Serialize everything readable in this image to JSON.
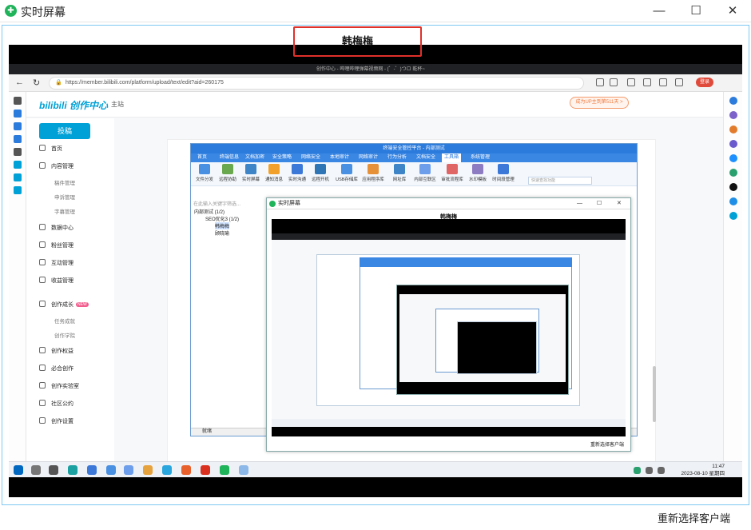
{
  "window": {
    "title": "实时屏幕",
    "controls": {
      "minimize": "—",
      "maximize": "☐",
      "close": "✕"
    }
  },
  "capture": {
    "user_name": "韩梅梅",
    "footer_button": "重新选择客户端"
  },
  "browser": {
    "tab_title": "创作中心 - 哔哩哔哩弹幕视频网 - (゜-゜)つロ 乾杯~",
    "url": "https://member.bilibili.com/platform/upload/text/edit?aid=260175",
    "login_label": "登录"
  },
  "bili": {
    "logo": "bilibili 创作中心",
    "home": "主站",
    "upgrade": "成为UP主到第511天 >",
    "upload_button": "投稿",
    "sidebar": [
      {
        "label": "首页",
        "sub": []
      },
      {
        "label": "内容管理",
        "sub": [
          "稿件管理",
          "申诉管理",
          "字幕管理"
        ]
      },
      {
        "label": "数据中心",
        "sub": []
      },
      {
        "label": "粉丝管理",
        "sub": []
      },
      {
        "label": "互动管理",
        "sub": []
      },
      {
        "label": "收益管理",
        "sub": []
      },
      {
        "label": "创作成长",
        "sub": [
          "任务成就",
          "创作学院"
        ]
      },
      {
        "label": "创作权益",
        "sub": []
      },
      {
        "label": "必合创作",
        "sub": []
      },
      {
        "label": "创作实验室",
        "sub": []
      },
      {
        "label": "社区公约",
        "sub": []
      },
      {
        "label": "创作设置",
        "sub": []
      }
    ],
    "new_badge": "NEW"
  },
  "security_app": {
    "title": "终端安全管控平台 - 内部测试",
    "menu": [
      "首页",
      "终端信息",
      "文档加密",
      "安全策略",
      "网络安全",
      "本地审计",
      "网络审计",
      "行为分析",
      "文档安全",
      "工具箱",
      "系统管理"
    ],
    "active_menu": "工具箱",
    "tools": [
      "文件分发",
      "远程协助",
      "实时屏幕",
      "通知消息",
      "实时沟通",
      "远程开机",
      "USB存储库",
      "应用程序库",
      "网址库",
      "内部互联区",
      "审批流程库",
      "水印模板",
      "时间段管理"
    ],
    "search_placeholder": "快速查找功能",
    "tree_search": "在此输入关键字筛选...",
    "tree": [
      "内部测试 (1/2)",
      "SEO优化3 (1/2)",
      "韩梅梅",
      "顾晓瑜"
    ],
    "status": "就绪"
  },
  "realtime_window": {
    "title": "实时屏幕",
    "name": "韩梅梅",
    "footer": "重新选择客户端"
  },
  "taskbar": {
    "time": "11:47",
    "date": "2023-08-10 星期四"
  }
}
